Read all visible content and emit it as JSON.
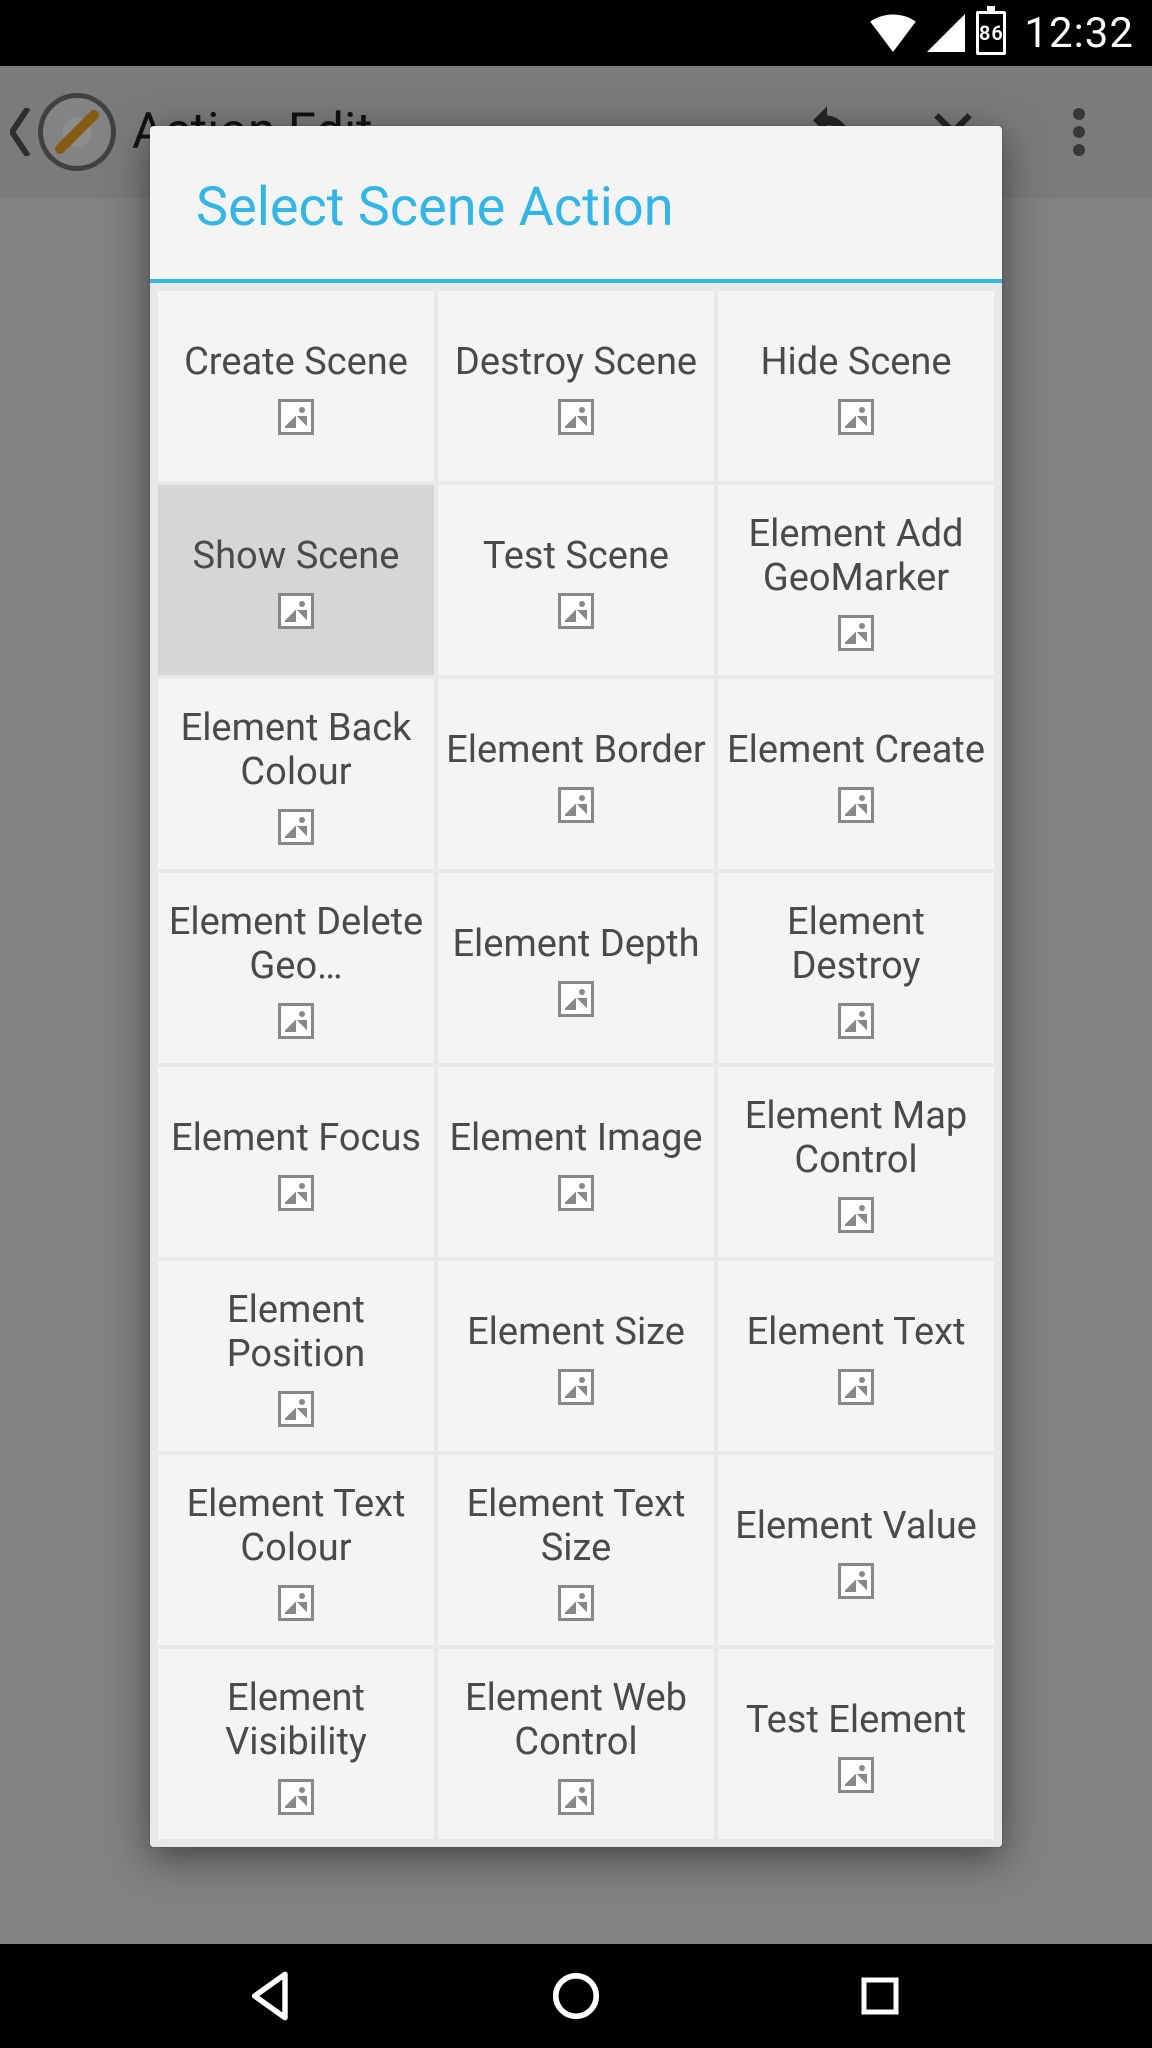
{
  "statusbar": {
    "battery_level": "86",
    "time": "12:32"
  },
  "actionbar": {
    "title": "Action Edit"
  },
  "dialog": {
    "title": "Select Scene Action",
    "items": [
      {
        "label": "Create Scene"
      },
      {
        "label": "Destroy Scene"
      },
      {
        "label": "Hide Scene"
      },
      {
        "label": "Show Scene",
        "selected": true
      },
      {
        "label": "Test Scene"
      },
      {
        "label": "Element Add GeoMarker"
      },
      {
        "label": "Element Back Colour"
      },
      {
        "label": "Element Border"
      },
      {
        "label": "Element Create"
      },
      {
        "label": "Element Delete Geo…"
      },
      {
        "label": "Element Depth"
      },
      {
        "label": "Element Destroy"
      },
      {
        "label": "Element Focus"
      },
      {
        "label": "Element Image"
      },
      {
        "label": "Element Map Control"
      },
      {
        "label": "Element Position"
      },
      {
        "label": "Element Size"
      },
      {
        "label": "Element Text"
      },
      {
        "label": "Element Text Colour"
      },
      {
        "label": "Element Text Size"
      },
      {
        "label": "Element Value"
      },
      {
        "label": "Element Visibility"
      },
      {
        "label": "Element Web Control"
      },
      {
        "label": "Test Element"
      }
    ]
  }
}
